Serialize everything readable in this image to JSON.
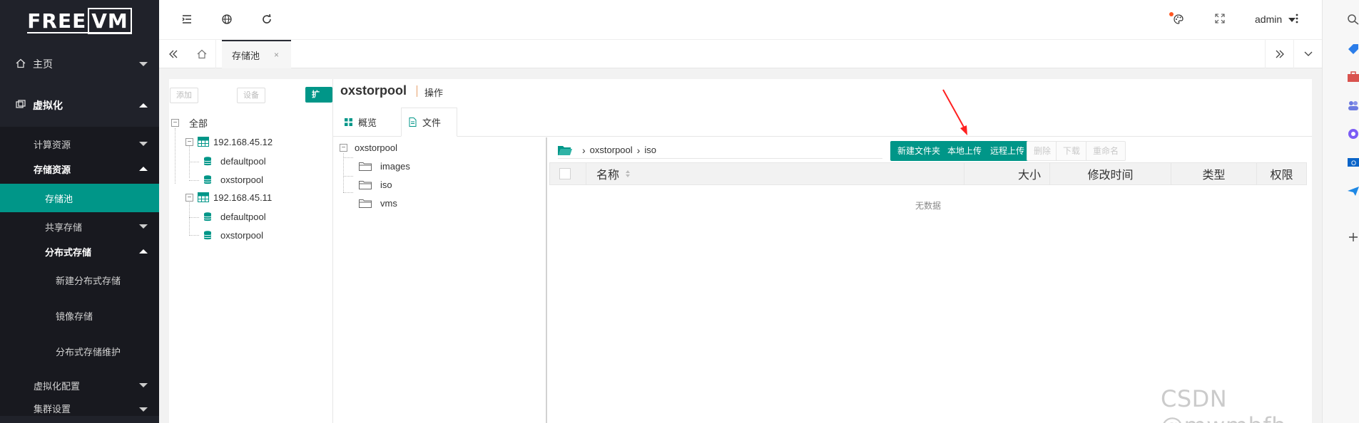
{
  "app": {
    "logo_left": "FREE",
    "logo_right": "VM",
    "brand_color": "#009688"
  },
  "sidebar": {
    "items": [
      {
        "label": "主页",
        "icon": "home-icon"
      },
      {
        "label": "虚拟化",
        "icon": "vm-icon"
      }
    ],
    "sub": {
      "compute": "计算资源",
      "storage": "存储资源",
      "storage_pool": "存储池",
      "shared": "共享存储",
      "distributed": "分布式存储",
      "new_distributed": "新建分布式存储",
      "mirror": "镜像存储",
      "maintain": "分布式存储维护",
      "vconfig": "虚拟化配置",
      "cluster": "集群设置"
    }
  },
  "header": {
    "user": "admin"
  },
  "tabs": {
    "active_label": "存储池",
    "close": "×"
  },
  "left_tree": {
    "btn_add": "添加",
    "btn_setting": "设备",
    "btn_expand": "扩展",
    "root": "全部",
    "hosts": [
      {
        "name": "192.168.45.12",
        "pools": [
          "defaultpool",
          "oxstorpool"
        ]
      },
      {
        "name": "192.168.45.11",
        "pools": [
          "defaultpool",
          "oxstorpool"
        ]
      }
    ]
  },
  "pool": {
    "name": "oxstorpool",
    "op": "操作",
    "tab_overview": "概览",
    "tab_files": "文件"
  },
  "file_tree": {
    "root": "oxstorpool",
    "folders": [
      "images",
      "iso",
      "vms"
    ]
  },
  "path": {
    "seg1": "oxstorpool",
    "seg2": "iso"
  },
  "actions": {
    "new_folder": "新建文件夹",
    "local_upload": "本地上传",
    "remote_upload": "远程上传",
    "delete": "删除",
    "download": "下载",
    "rename": "重命名"
  },
  "table": {
    "columns": [
      "名称",
      "大小",
      "修改时间",
      "类型",
      "权限"
    ],
    "empty": "无数据"
  },
  "watermark": "CSDN @mwmbfh"
}
